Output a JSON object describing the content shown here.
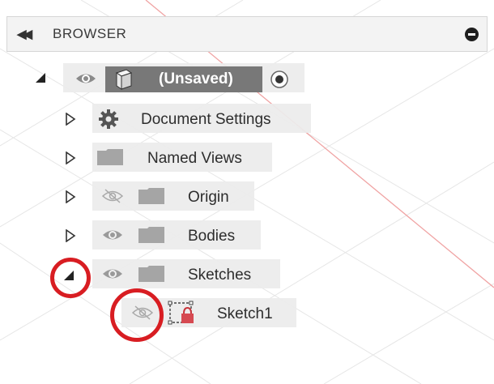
{
  "browser": {
    "title": "BROWSER",
    "collapse_icon": "double-chevron-left-icon",
    "menu_icon": "minus-circle-icon"
  },
  "tree": {
    "root": {
      "label": "(Unsaved)",
      "expanded": true,
      "visible": true,
      "icons": [
        "eye-icon",
        "component-icon",
        "radio-active-icon"
      ]
    },
    "items": [
      {
        "label": "Document Settings",
        "expanded": false,
        "icon": "gear-icon"
      },
      {
        "label": "Named Views",
        "expanded": false,
        "icon": "folder-icon"
      },
      {
        "label": "Origin",
        "expanded": false,
        "visible": false,
        "icon": "folder-icon"
      },
      {
        "label": "Bodies",
        "expanded": false,
        "visible": true,
        "icon": "folder-icon"
      },
      {
        "label": "Sketches",
        "expanded": true,
        "visible": true,
        "icon": "folder-icon"
      },
      {
        "label": "Sketch1",
        "visible": false,
        "icon": "sketch-locked-icon"
      }
    ]
  },
  "colors": {
    "highlight": "#d81d22",
    "component_bar": "#777777"
  }
}
